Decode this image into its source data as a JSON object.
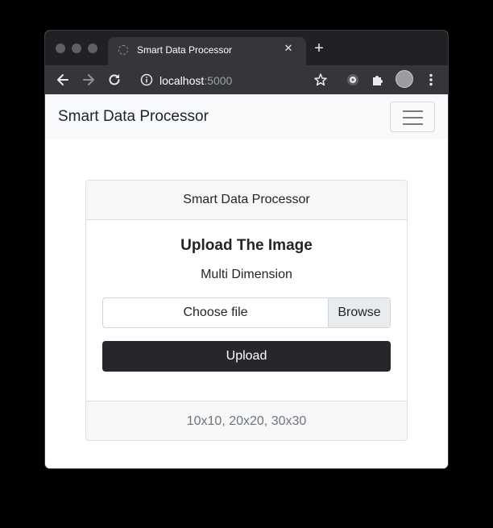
{
  "browser": {
    "tab_title": "Smart Data Processor",
    "tab_close": "✕",
    "new_tab": "+",
    "url_host": "localhost",
    "url_port": ":5000",
    "icons": [
      "back-arrow-icon",
      "forward-arrow-icon",
      "reload-icon",
      "info-icon",
      "star-icon",
      "extension-icon",
      "puzzle-icon",
      "profile-avatar",
      "more-menu-icon"
    ]
  },
  "navbar": {
    "brand": "Smart Data Processor"
  },
  "card": {
    "header": "Smart Data Processor",
    "title": "Upload The Image",
    "subtitle": "Multi Dimension",
    "file_label": "Choose file",
    "browse_label": "Browse",
    "upload_label": "Upload",
    "footer": "10x10, 20x20, 30x30"
  },
  "colors": {
    "chrome_dark": "#202124",
    "chrome_toolbar": "#35363a",
    "navbar_bg": "#f8f9fa",
    "upload_button": "#26272b",
    "muted_text": "#6c757d"
  }
}
